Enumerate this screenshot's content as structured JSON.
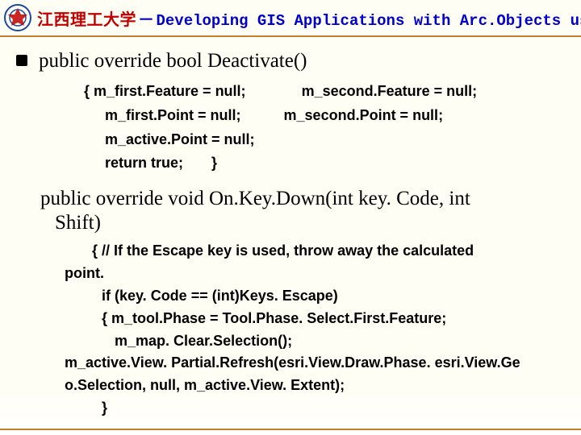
{
  "header": {
    "university": "江西理工大学",
    "separator": "－",
    "course": "Developing GIS Applications with Arc.Objects using C#. NE"
  },
  "section1": {
    "signature": "public override bool Deactivate()",
    "lines": {
      "l1a": "{   m_first.Feature = null;",
      "l1b": "m_second.Feature = null;",
      "l2a": "m_first.Point = null;",
      "l2b": "m_second.Point = null;",
      "l3": "m_active.Point = null;",
      "l4a": "return true;",
      "l4b": "}"
    }
  },
  "section2": {
    "signature_a": "public override void On.Key.Down(int key. Code, int",
    "signature_b": "Shift)",
    "lines": {
      "l1": "{      // If the Escape key is used, throw away the calculated",
      "l1b": "point.",
      "l2": "if (key. Code == (int)Keys. Escape)",
      "l3": "{    m_tool.Phase = Tool.Phase. Select.First.Feature;",
      "l4": "m_map. Clear.Selection();",
      "l5": "m_active.View. Partial.Refresh(esri.View.Draw.Phase. esri.View.Ge",
      "l5b": "o.Selection, null, m_active.View. Extent);",
      "l6": "}"
    }
  }
}
